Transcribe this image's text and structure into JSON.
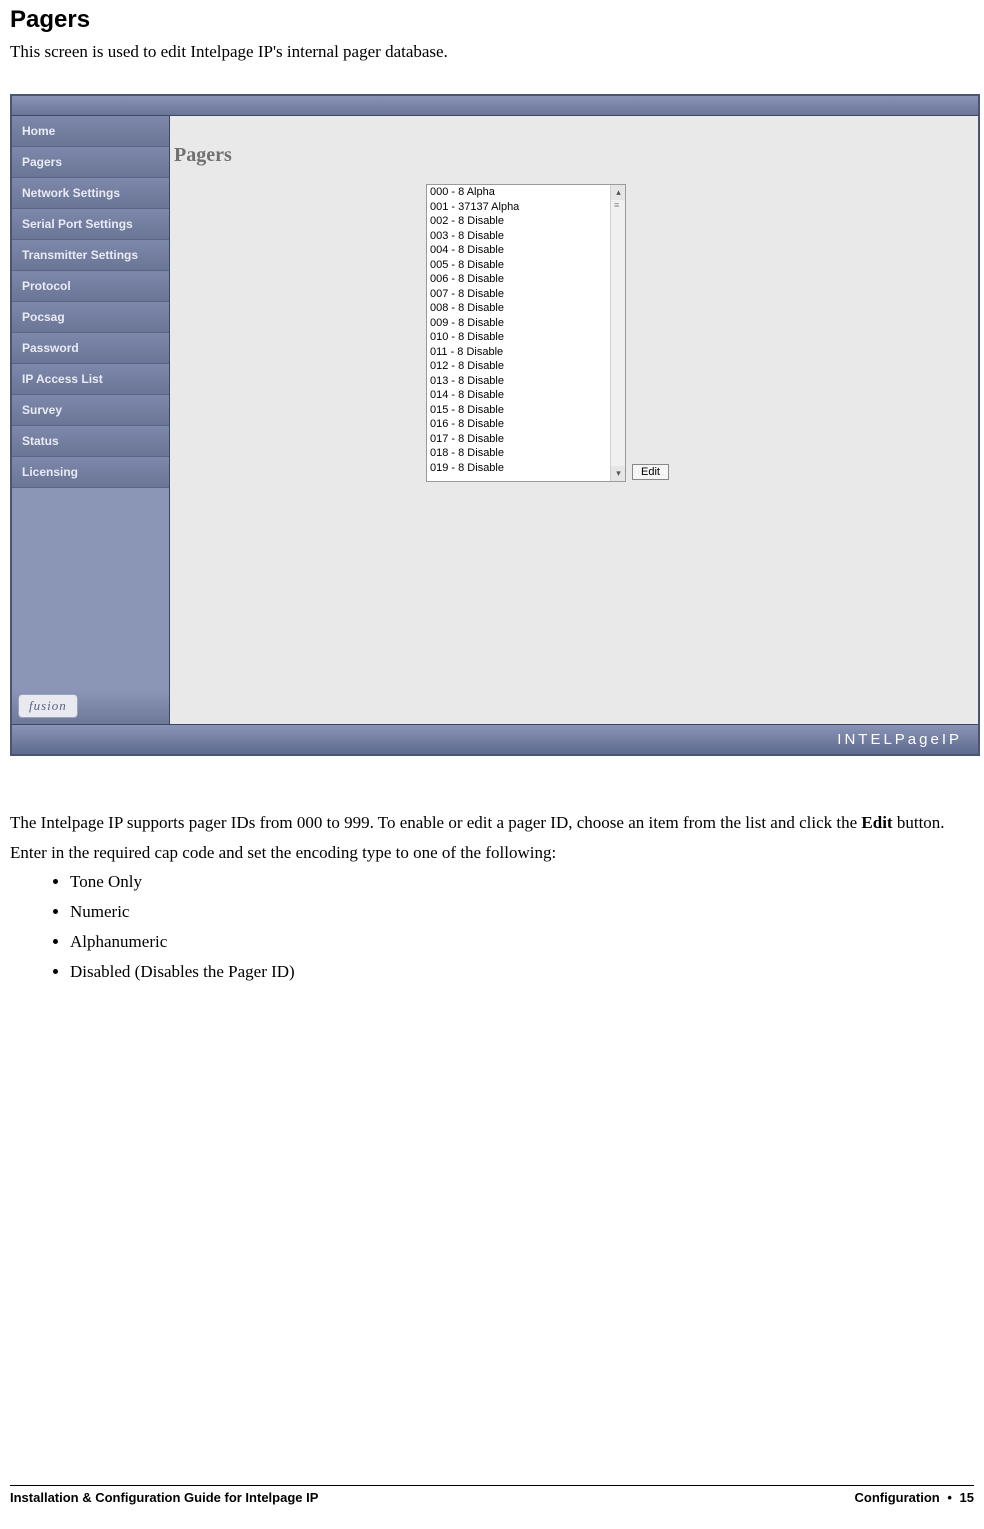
{
  "heading": "Pagers",
  "intro": "This screen is used to edit Intelpage IP's internal pager database.",
  "sidebar": {
    "logo": "fusion",
    "items": [
      "Home",
      "Pagers",
      "Network Settings",
      "Serial Port Settings",
      "Transmitter Settings",
      "Protocol",
      "Pocsag",
      "Password",
      "IP Access List",
      "Survey",
      "Status",
      "Licensing"
    ]
  },
  "main": {
    "title": "Pagers",
    "edit_button": "Edit",
    "list": [
      "000 - 8 Alpha",
      "001 - 37137 Alpha",
      "002 - 8 Disable",
      "003 - 8 Disable",
      "004 - 8 Disable",
      "005 - 8 Disable",
      "006 - 8 Disable",
      "007 - 8 Disable",
      "008 - 8 Disable",
      "009 - 8 Disable",
      "010 - 8 Disable",
      "011 - 8 Disable",
      "012 - 8 Disable",
      "013 - 8 Disable",
      "014 - 8 Disable",
      "015 - 8 Disable",
      "016 - 8 Disable",
      "017 - 8 Disable",
      "018 - 8 Disable",
      "019 - 8 Disable"
    ]
  },
  "footer_brand": "INTELPageIP",
  "explain": {
    "p1_a": "The Intelpage IP supports pager IDs from 000 to 999. To enable or edit a pager ID, choose an item from the list and click the ",
    "p1_b": "Edit",
    "p1_c": " button.",
    "p2": "Enter in the required cap code and set the encoding type to one of the following:",
    "bullets": [
      "Tone Only",
      "Numeric",
      "Alphanumeric",
      "Disabled (Disables the Pager ID)"
    ]
  },
  "page_footer": {
    "left": "Installation & Configuration Guide for Intelpage IP",
    "right_section": "Configuration",
    "right_dot": "•",
    "right_page": "15"
  }
}
